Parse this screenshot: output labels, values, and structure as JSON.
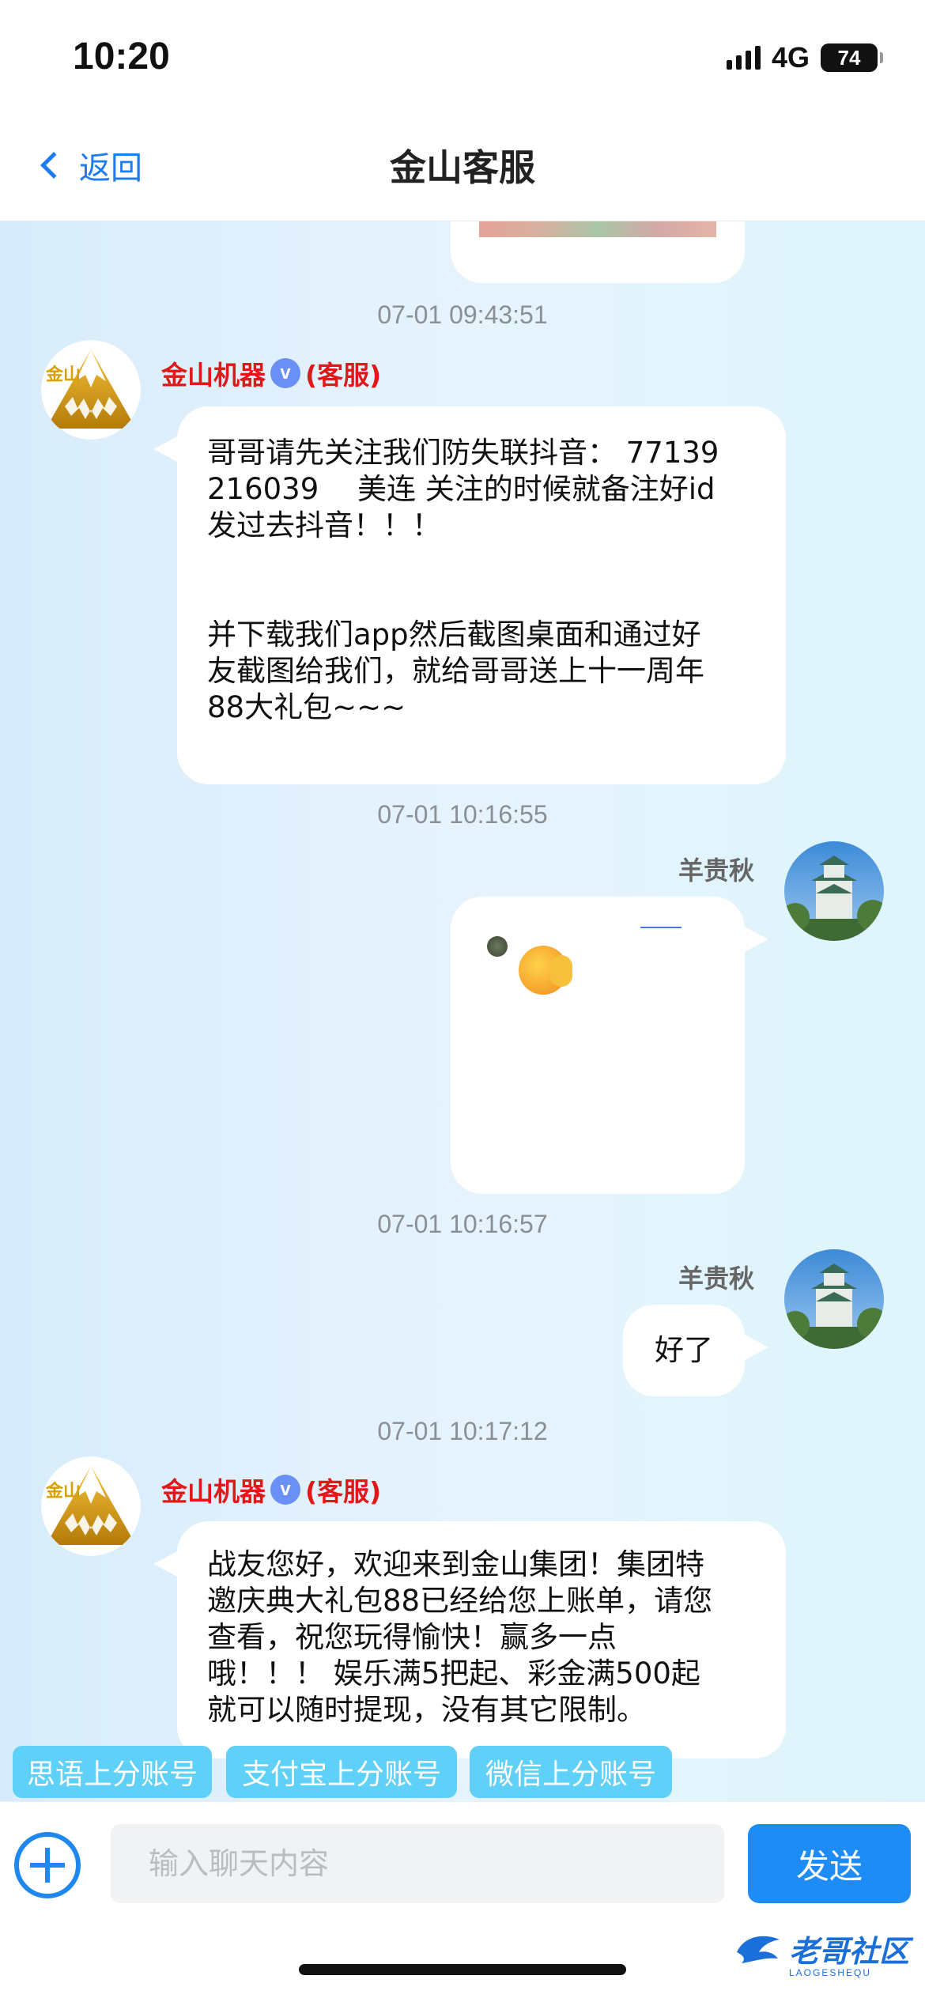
{
  "status_bar": {
    "time": "10:20",
    "network": "4G",
    "battery": "74"
  },
  "nav": {
    "back_label": "返回",
    "title": "金山客服"
  },
  "messages": {
    "ts1": "07-01 09:43:51",
    "agent_name": "金山机器",
    "agent_badge": "v",
    "agent_role": "(客服)",
    "agent_logo": "金山",
    "msg1_lines": [
      "哥哥请先关注我们防失联抖音： 77139",
      "216039　 美连 关注的时候就备注好id",
      "发过去抖音！！！",
      "",
      "",
      "并下载我们app然后截图桌面和通过好",
      "友截图给我们，就给哥哥送上十一周年",
      "88大礼包~~~"
    ],
    "ts2": "07-01 10:16:55",
    "user_name": "羊贵秋",
    "ts3": "07-01 10:16:57",
    "msg3_text": "好了",
    "ts4": "07-01 10:17:12",
    "msg4_lines": [
      "战友您好，欢迎来到金山集团！集团特",
      "邀庆典大礼包88已经给您上账单，请您",
      "查看，祝您玩得愉快！赢多一点",
      "哦！！！ 娱乐满5把起、彩金满500起",
      "就可以随时提现，没有其它限制。"
    ]
  },
  "quick_replies": [
    "思语上分账号",
    "支付宝上分账号",
    "微信上分账号"
  ],
  "input": {
    "placeholder": "输入聊天内容",
    "send_label": "发送"
  },
  "watermark": {
    "text": "老哥社区",
    "sub": "LAOGESHEQU"
  }
}
